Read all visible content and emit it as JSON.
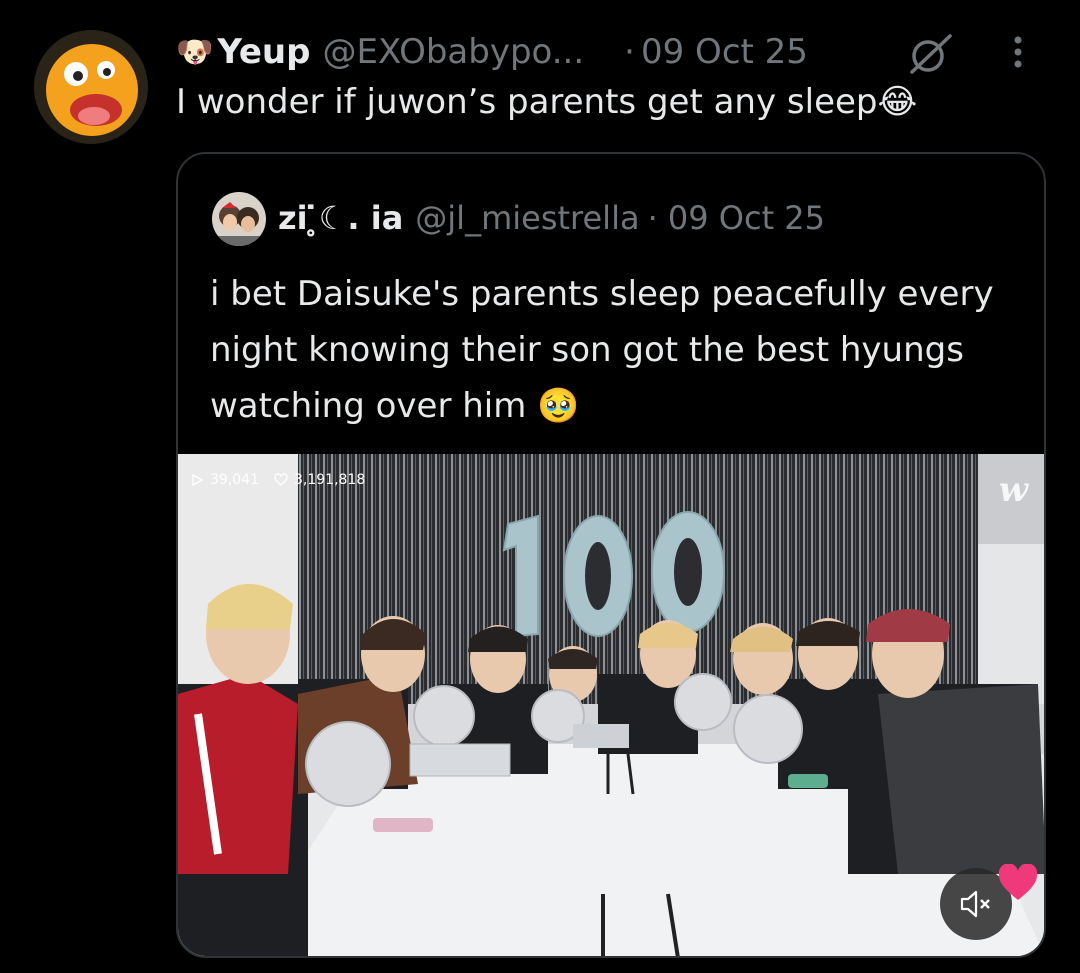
{
  "tweet": {
    "emoji": "🐶",
    "display_name": "Yeup",
    "handle": "@EXObabypo...",
    "dot": "·",
    "date": "09 Oct 25",
    "text": "I wonder if juwon’s parents get any sleep😂"
  },
  "quoted": {
    "display_name": "zi ̥̇☾. ia",
    "handle": "@jl_miestrella",
    "date": "· 09 Oct 25",
    "text": "i bet Daisuke's parents sleep peacefully every night knowing their son got the best hyungs watching over him 🥹",
    "media": {
      "views": "39,041",
      "likes": "3,191,818",
      "watermark": "w",
      "balloon_text": "100"
    }
  },
  "colors": {
    "background": "#000000",
    "text_primary": "#e7e9ea",
    "text_secondary": "#71767b",
    "border": "#2f3336"
  },
  "icons": [
    "dog-emoji-icon",
    "grok-icon",
    "more-icon",
    "play-icon",
    "heart-outline-icon",
    "mute-icon",
    "heart-icon"
  ]
}
